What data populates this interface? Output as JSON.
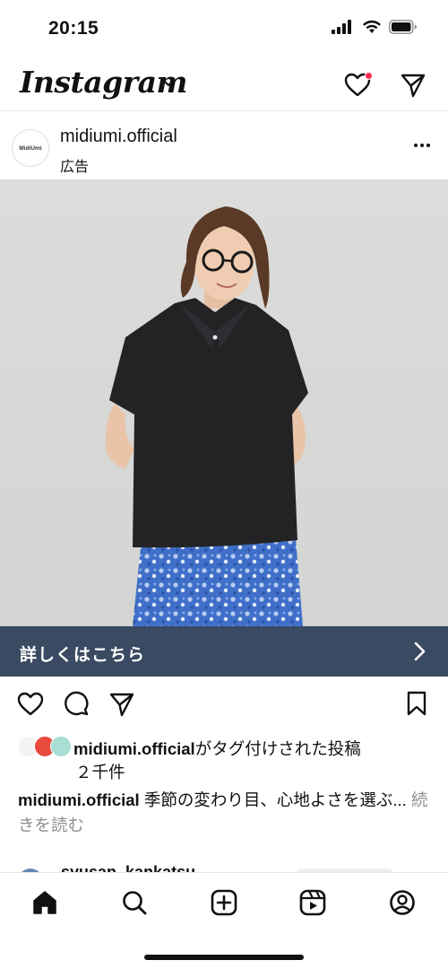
{
  "status_bar": {
    "time": "20:15",
    "icons": [
      "signal-icon",
      "wifi-icon",
      "battery-icon"
    ]
  },
  "header": {
    "logo_text": "Instagram",
    "icons": [
      "chevron-down-icon",
      "heart-icon",
      "send-icon"
    ],
    "notification_dot_color": "#ff2d55"
  },
  "post": {
    "account": "midiumi.official",
    "avatar_text": "MidiUmi",
    "sponsored_label": "広告",
    "cta_label": "詳しくはこちら",
    "cta_color": "#3b4a63",
    "tagged": {
      "account": "midiumi.official",
      "suffix": "がタグ付けされた投稿",
      "count": "２千件"
    },
    "caption": {
      "account": "midiumi.official",
      "text": " 季節の変わり目、心地よさを選ぶ...",
      "more": "続きを読む"
    }
  },
  "next_post": {
    "account": "syusan_kankatsu"
  },
  "tab_bar": {
    "items": [
      "home-icon",
      "search-icon",
      "create-icon",
      "reels-icon",
      "profile-icon"
    ]
  }
}
